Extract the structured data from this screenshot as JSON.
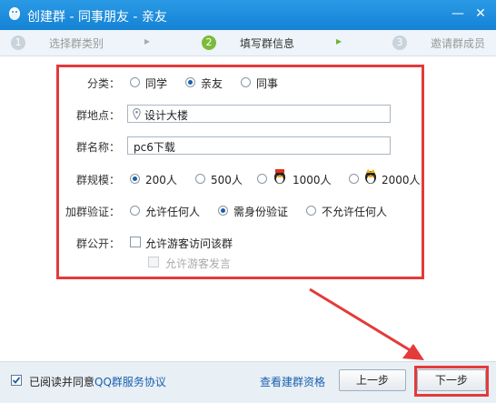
{
  "window": {
    "title": "创建群 - 同事朋友 - 亲友",
    "minimize": "—",
    "close": "✕"
  },
  "steps": [
    {
      "num": "1",
      "label": "选择群类别"
    },
    {
      "num": "2",
      "label": "填写群信息"
    },
    {
      "num": "3",
      "label": "邀请群成员"
    }
  ],
  "step_arrow": "▸",
  "form": {
    "category": {
      "label": "分类：",
      "options": [
        "同学",
        "亲友",
        "同事"
      ],
      "selected": "亲友"
    },
    "location": {
      "label": "群地点：",
      "value": "设计大楼"
    },
    "name": {
      "label": "群名称：",
      "value": "pc6下载"
    },
    "size": {
      "label": "群规模：",
      "options": [
        "200人",
        "500人",
        "1000人",
        "2000人"
      ],
      "selected": "200人"
    },
    "verify": {
      "label": "加群验证：",
      "options": [
        "允许任何人",
        "需身份验证",
        "不允许任何人"
      ],
      "selected": "需身份验证"
    },
    "public": {
      "label": "群公开：",
      "option1": "允许游客访问该群",
      "option2": "允许游客发言"
    }
  },
  "footer": {
    "agree_prefix": "已阅读并同意",
    "agree_link": "QQ群服务协议",
    "qualify_link": "查看建群资格",
    "prev_button": "上一步",
    "next_button": "下一步"
  },
  "colors": {
    "annotation_red": "#e53a3a",
    "accent_blue": "#1582d4"
  }
}
